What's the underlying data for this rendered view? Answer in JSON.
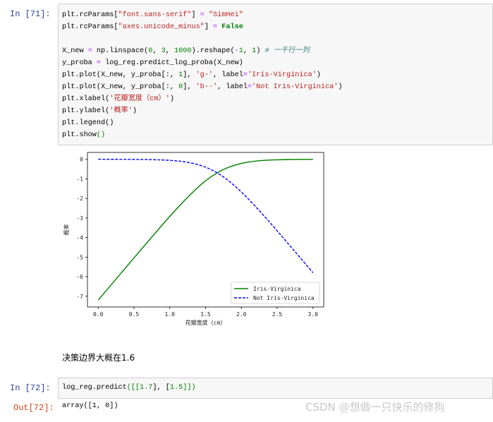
{
  "cells": {
    "cell71": {
      "prompt": "In  [71]:",
      "lines": [
        [
          [
            "plt.rcParams[",
            "p"
          ],
          [
            "″font.sans-serif″",
            "s"
          ],
          [
            "] ",
            "p"
          ],
          [
            "=",
            "o"
          ],
          [
            " ″SimHei″",
            "s"
          ]
        ],
        [
          [
            "plt.rcParams[",
            "p"
          ],
          [
            "″axes.unicode_minus″",
            "s"
          ],
          [
            "] ",
            "p"
          ],
          [
            "=",
            "o"
          ],
          [
            " ",
            "p"
          ],
          [
            "False",
            "k"
          ]
        ],
        [],
        [
          [
            "X_new ",
            "p"
          ],
          [
            "=",
            "o"
          ],
          [
            " np.linspace(",
            "p"
          ],
          [
            "0",
            "n"
          ],
          [
            ", ",
            "p"
          ],
          [
            "3",
            "n"
          ],
          [
            ", ",
            "p"
          ],
          [
            "1000",
            "n"
          ],
          [
            ").reshape(",
            "p"
          ],
          [
            "-",
            "o"
          ],
          [
            "1",
            "n"
          ],
          [
            ", ",
            "p"
          ],
          [
            "1",
            "n"
          ],
          [
            ") ",
            "p"
          ],
          [
            "# 一千行一列",
            "c"
          ]
        ],
        [
          [
            "y_proba ",
            "p"
          ],
          [
            "=",
            "o"
          ],
          [
            " log_reg.predict_log_proba(X_new)",
            "p"
          ]
        ],
        [
          [
            "plt.plot(X_new, y_proba[:, ",
            "p"
          ],
          [
            "1",
            "n"
          ],
          [
            "], ",
            "p"
          ],
          [
            "'g-'",
            "s"
          ],
          [
            ", label",
            "p"
          ],
          [
            "=",
            "o"
          ],
          [
            "'Iris-Virginica'",
            "s"
          ],
          [
            ")",
            "p"
          ]
        ],
        [
          [
            "plt.plot(X_new, y_proba[:, ",
            "p"
          ],
          [
            "0",
            "n"
          ],
          [
            "], ",
            "p"
          ],
          [
            "'b--'",
            "s"
          ],
          [
            ", label",
            "p"
          ],
          [
            "=",
            "o"
          ],
          [
            "'Not Iris-Virginica'",
            "s"
          ],
          [
            ")",
            "p"
          ]
        ],
        [
          [
            "plt.xlabel(",
            "p"
          ],
          [
            "'花瓣宽度（cm）'",
            "s"
          ],
          [
            ")",
            "p"
          ]
        ],
        [
          [
            "plt.ylabel(",
            "p"
          ],
          [
            "'概率'",
            "s"
          ],
          [
            ")",
            "p"
          ]
        ],
        [
          [
            "plt.legend()",
            "p"
          ]
        ],
        [
          [
            "plt.show",
            "p"
          ],
          [
            "()",
            "n"
          ]
        ]
      ]
    },
    "markdown": "决策边界大概在1.6",
    "cell72": {
      "prompt": "In  [72]:",
      "lines": [
        [
          [
            "log_reg.predict",
            "p"
          ],
          [
            "([[",
            "n"
          ],
          [
            "1.7",
            "n"
          ],
          [
            "], [",
            "p"
          ],
          [
            "1.5",
            "n"
          ],
          [
            "]])",
            "n"
          ]
        ]
      ],
      "out_prompt": "Out[72]:",
      "output": "array([1, 0])"
    }
  },
  "watermark": "CSDN @想做一只快乐的修狗",
  "chart_data": {
    "type": "line",
    "xlabel": "花瓣宽度（cm）",
    "ylabel": "概率",
    "xlim": [
      -0.15,
      3.15
    ],
    "ylim": [
      -7.55,
      0.35
    ],
    "xticks": [
      "0.0",
      "0.5",
      "1.0",
      "1.5",
      "2.0",
      "2.5",
      "3.0"
    ],
    "yticks": [
      "0",
      "-1",
      "-2",
      "-3",
      "-4",
      "-5",
      "-6",
      "-7"
    ],
    "grid": false,
    "legend": "bottom-right",
    "x": [
      0,
      0.25,
      0.5,
      0.75,
      1.0,
      1.25,
      1.5,
      1.75,
      2.0,
      2.25,
      2.5,
      2.75,
      3.0
    ],
    "series": [
      {
        "name": "Iris-Virginica",
        "color": "#008000",
        "style": "solid",
        "values": [
          -7.2,
          -6.12,
          -5.04,
          -3.97,
          -2.92,
          -1.94,
          -1.1,
          -0.52,
          -0.21,
          -0.075,
          -0.026,
          -0.009,
          -0.003
        ]
      },
      {
        "name": "Not Iris-Virginica",
        "color": "#0000ff",
        "style": "dashed",
        "values": [
          -0.001,
          -0.002,
          -0.007,
          -0.019,
          -0.055,
          -0.156,
          -0.403,
          -0.903,
          -1.674,
          -2.625,
          -3.66,
          -4.726,
          -5.803
        ]
      }
    ]
  }
}
